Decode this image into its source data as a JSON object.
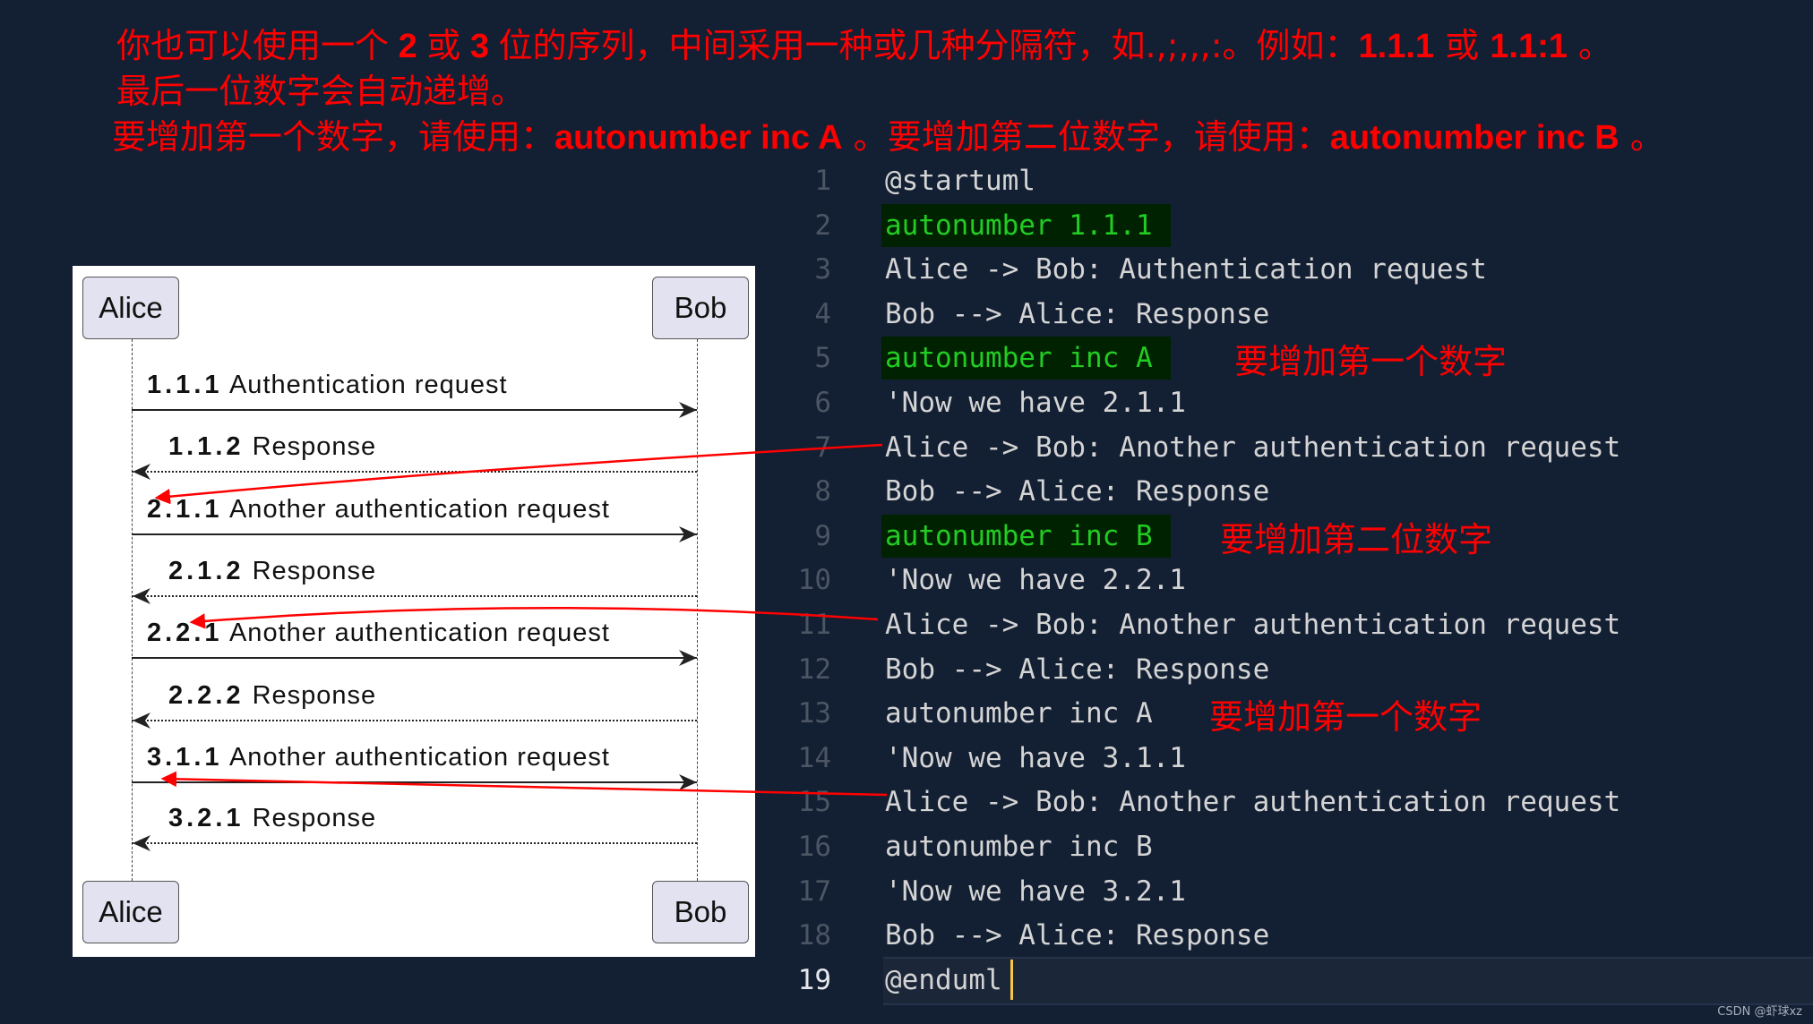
{
  "heading": {
    "line1_parts": [
      "你也可以使用一个",
      " 2 ",
      "或",
      " 3 ",
      "位的序列，中间采用一种或几种分隔符，如.,;,,,:。例如：",
      "1.1.1",
      " 或 ",
      "1.1:1",
      " 。"
    ],
    "line2": "最后一位数字会自动递增。",
    "line3_parts": [
      "要增加第一个数字，请使用：",
      "autonumber inc A",
      " 。要增加第二位数字，请使用：",
      "autonumber inc B",
      " 。"
    ]
  },
  "diagram": {
    "participants": [
      "Alice",
      "Bob"
    ],
    "messages": [
      {
        "number": "1.1.1",
        "text": "Authentication request",
        "from": "Alice",
        "to": "Bob",
        "style": "solid"
      },
      {
        "number": "1.1.2",
        "text": "Response",
        "from": "Bob",
        "to": "Alice",
        "style": "dashed"
      },
      {
        "number": "2.1.1",
        "text": "Another authentication request",
        "from": "Alice",
        "to": "Bob",
        "style": "solid"
      },
      {
        "number": "2.1.2",
        "text": "Response",
        "from": "Bob",
        "to": "Alice",
        "style": "dashed"
      },
      {
        "number": "2.2.1",
        "text": "Another authentication request",
        "from": "Alice",
        "to": "Bob",
        "style": "solid"
      },
      {
        "number": "2.2.2",
        "text": "Response",
        "from": "Bob",
        "to": "Alice",
        "style": "dashed"
      },
      {
        "number": "3.1.1",
        "text": "Another authentication request",
        "from": "Alice",
        "to": "Bob",
        "style": "solid"
      },
      {
        "number": "3.2.1",
        "text": "Response",
        "from": "Bob",
        "to": "Alice",
        "style": "dashed"
      }
    ]
  },
  "editor": {
    "lines": [
      {
        "n": "1",
        "text": "@startuml",
        "highlight": false
      },
      {
        "n": "2",
        "text": "autonumber 1.1.1",
        "highlight": true
      },
      {
        "n": "3",
        "text": "Alice -> Bob: Authentication request",
        "highlight": false
      },
      {
        "n": "4",
        "text": "Bob --> Alice: Response",
        "highlight": false
      },
      {
        "n": "5",
        "text": "autonumber inc A",
        "highlight": true
      },
      {
        "n": "6",
        "text": "'Now we have 2.1.1",
        "highlight": false
      },
      {
        "n": "7",
        "text": "Alice -> Bob: Another authentication request",
        "highlight": false
      },
      {
        "n": "8",
        "text": "Bob --> Alice: Response",
        "highlight": false
      },
      {
        "n": "9",
        "text": "autonumber inc B",
        "highlight": true
      },
      {
        "n": "10",
        "text": "'Now we have 2.2.1",
        "highlight": false
      },
      {
        "n": "11",
        "text": "Alice -> Bob: Another authentication request",
        "highlight": false
      },
      {
        "n": "12",
        "text": "Bob --> Alice: Response",
        "highlight": false
      },
      {
        "n": "13",
        "text": "autonumber inc A",
        "highlight": false
      },
      {
        "n": "14",
        "text": "'Now we have 3.1.1",
        "highlight": false
      },
      {
        "n": "15",
        "text": "Alice -> Bob: Another authentication request",
        "highlight": false
      },
      {
        "n": "16",
        "text": "autonumber inc B",
        "highlight": false
      },
      {
        "n": "17",
        "text": "'Now we have 3.2.1",
        "highlight": false
      },
      {
        "n": "18",
        "text": "Bob --> Alice: Response",
        "highlight": false
      },
      {
        "n": "19",
        "text": "@enduml",
        "highlight": false
      }
    ],
    "current_line": 19,
    "annotations": [
      {
        "line": 5,
        "text": "要增加第一个数字"
      },
      {
        "line": 9,
        "text": "要增加第二位数字"
      },
      {
        "line": 13,
        "text": "要增加第一个数字"
      }
    ]
  },
  "colors": {
    "background": "#131f33",
    "annotation_red": "#ff0000",
    "highlight_bg": "#002200",
    "highlight_fg": "#22cc22",
    "cursor": "#f6c744",
    "participant_fill": "#e2e2f0"
  },
  "watermark": "CSDN @虾球xz"
}
